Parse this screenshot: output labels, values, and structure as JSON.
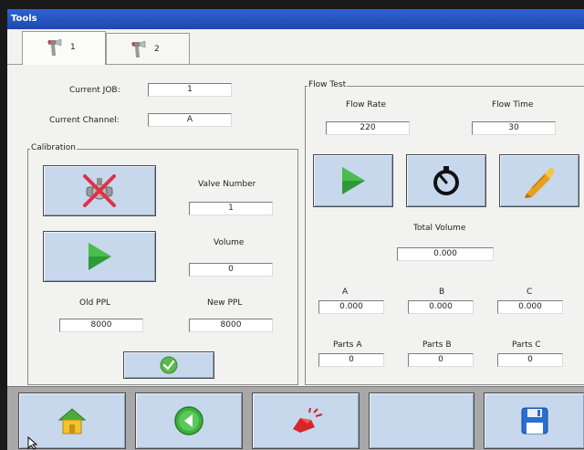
{
  "window": {
    "title": "Tools"
  },
  "tabs": [
    {
      "label": "1",
      "icon": "spray-gun-icon",
      "active": true
    },
    {
      "label": "2",
      "icon": "spray-gun-icon",
      "active": false
    }
  ],
  "job": {
    "current_job_label": "Current JOB:",
    "current_job_value": "1",
    "current_channel_label": "Current Channel:",
    "current_channel_value": "A"
  },
  "calibration": {
    "title": "Calibration",
    "valve_number_label": "Valve Number",
    "valve_number_value": "1",
    "volume_label": "Volume",
    "volume_value": "0",
    "old_ppl_label": "Old PPL",
    "old_ppl_value": "8000",
    "new_ppl_label": "New PPL",
    "new_ppl_value": "8000"
  },
  "flow_test": {
    "title": "Flow Test",
    "flow_rate_label": "Flow Rate",
    "flow_rate_value": "220",
    "flow_time_label": "Flow Time",
    "flow_time_value": "30",
    "total_volume_label": "Total Volume",
    "total_volume_value": "0.000",
    "channels": [
      {
        "label": "A",
        "value": "0.000",
        "parts_label": "Parts A",
        "parts_value": "0"
      },
      {
        "label": "B",
        "value": "0.000",
        "parts_label": "Parts B",
        "parts_value": "0"
      },
      {
        "label": "C",
        "value": "0.000",
        "parts_label": "Parts C",
        "parts_value": "0"
      }
    ]
  },
  "bottom_bar": {
    "buttons": [
      "home-icon",
      "back-arrow-icon",
      "alarm-beacon-icon",
      "empty",
      "save-disk-icon"
    ]
  },
  "colors": {
    "title_bar": "#2556c2",
    "button_face": "#c7d7ec",
    "play_green": "#2e9a36",
    "bottom_bar": "#a8a8a8"
  }
}
